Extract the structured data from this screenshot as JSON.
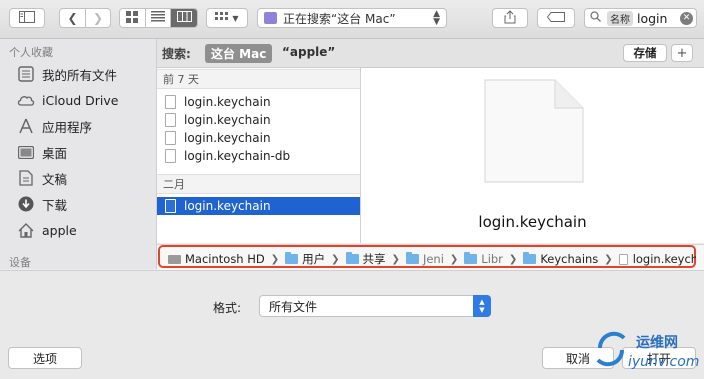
{
  "toolbar": {
    "location_label": "正在搜索“这台 Mac”",
    "search_token": "名称",
    "search_value": "login"
  },
  "sidebar": {
    "favorites_heading": "个人收藏",
    "items": [
      {
        "label": "我的所有文件",
        "icon": "all-files-icon"
      },
      {
        "label": "iCloud Drive",
        "icon": "cloud-icon"
      },
      {
        "label": "应用程序",
        "icon": "applications-icon"
      },
      {
        "label": "桌面",
        "icon": "desktop-icon"
      },
      {
        "label": "文稿",
        "icon": "documents-icon"
      },
      {
        "label": "下载",
        "icon": "download-icon"
      },
      {
        "label": "apple",
        "icon": "home-icon"
      }
    ],
    "devices_heading": "设备"
  },
  "search_scope": {
    "label": "搜索:",
    "scope_mac": "这台 Mac",
    "query": "“apple”",
    "save_label": "存储",
    "add_label": "+"
  },
  "results": {
    "groups": [
      {
        "title": "前 7 天",
        "files": [
          "login.keychain",
          "login.keychain",
          "login.keychain",
          "login.keychain-db"
        ]
      },
      {
        "title": "二月",
        "files": [
          "login.keychain"
        ]
      }
    ]
  },
  "preview": {
    "filename": "login.keychain"
  },
  "path": [
    "Macintosh HD",
    "用户",
    "共享",
    "Jeni",
    "Libr",
    "Keychains",
    "login.keychai"
  ],
  "format": {
    "label": "格式:",
    "value": "所有文件"
  },
  "buttons": {
    "options": "选项",
    "cancel": "取消",
    "open": "打开"
  },
  "watermark": {
    "line1": "运维网",
    "line2": "iyunv.com"
  },
  "colors": {
    "accent": "#1f62d2",
    "highlight_frame": "#e0452b"
  }
}
